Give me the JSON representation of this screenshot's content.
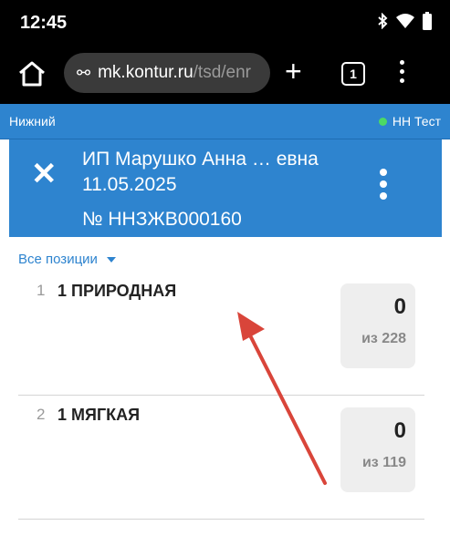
{
  "status_bar": {
    "time": "12:45",
    "icons": [
      "bluetooth-icon",
      "wifi-icon",
      "battery-icon"
    ]
  },
  "browser": {
    "url_host": "mk.kontur.ru",
    "url_path": "/tsd/enr",
    "tab_count": "1"
  },
  "subheader": {
    "location": "Нижний",
    "env": "НН Тест",
    "env_status_color": "#4cd964"
  },
  "doc_header": {
    "name": "ИП Марушко Анна … евна",
    "date": "11.05.2025",
    "number": "№ ННЗЖВ000160"
  },
  "filter": {
    "label": "Все позиции"
  },
  "items": [
    {
      "index": "1",
      "title": "1 ПРИРОДНАЯ",
      "count": "0",
      "of": "из 228"
    },
    {
      "index": "2",
      "title": "1 МЯГКАЯ",
      "count": "0",
      "of": "из 119"
    }
  ],
  "colors": {
    "accent": "#2e84cf",
    "annotation_arrow": "#d9453a"
  }
}
